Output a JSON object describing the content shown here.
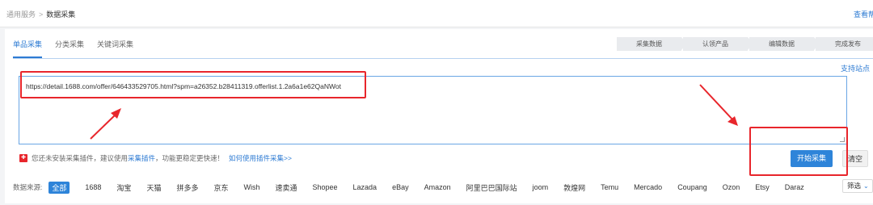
{
  "breadcrumb": {
    "parent": "通用服务",
    "current": "数据采集"
  },
  "header": {
    "help_link": "查看帮"
  },
  "tabs": [
    {
      "label": "单品采集",
      "active": true
    },
    {
      "label": "分类采集",
      "active": false
    },
    {
      "label": "关键词采集",
      "active": false
    }
  ],
  "steps": [
    "采集数据",
    "认领产品",
    "编辑数据",
    "完成发布"
  ],
  "support_link": "支持站点",
  "url_input": {
    "value": "https://detail.1688.com/offer/646433529705.html?spm=a26352.b28411319.offerlist.1.2a6a1e62QaNWot"
  },
  "notice": {
    "icon": "flag-icon",
    "text1": "您还未安装采集插件，建议使用",
    "plugin_link": "采集插件",
    "text2": "，功能更稳定更快速！",
    "howto_link": "如何使用插件采集>>"
  },
  "buttons": {
    "start": "开始采集",
    "clear": "清空"
  },
  "sources": {
    "label": "数据来源:",
    "items": [
      {
        "label": "全部",
        "active": true
      },
      {
        "label": "1688"
      },
      {
        "label": "淘宝"
      },
      {
        "label": "天猫"
      },
      {
        "label": "拼多多"
      },
      {
        "label": "京东"
      },
      {
        "label": "Wish"
      },
      {
        "label": "速卖通"
      },
      {
        "label": "Shopee"
      },
      {
        "label": "Lazada"
      },
      {
        "label": "eBay"
      },
      {
        "label": "Amazon"
      },
      {
        "label": "阿里巴巴国际站"
      },
      {
        "label": "joom"
      },
      {
        "label": "敦煌网"
      },
      {
        "label": "Temu"
      },
      {
        "label": "Mercado"
      },
      {
        "label": "Coupang"
      },
      {
        "label": "Ozon"
      },
      {
        "label": "Etsy"
      },
      {
        "label": "Daraz"
      }
    ],
    "filter_label": "筛选"
  },
  "colors": {
    "accent": "#2e84d9",
    "annotation": "#e8262c"
  }
}
